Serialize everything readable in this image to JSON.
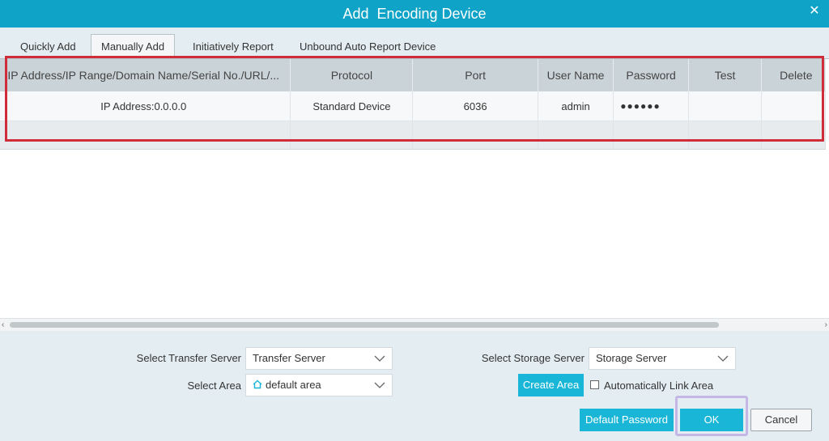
{
  "window": {
    "title": "Add  Encoding Device",
    "close_glyph": "✕"
  },
  "tabs": [
    {
      "label": "Quickly Add"
    },
    {
      "label": "Manually Add",
      "active": true
    },
    {
      "label": "Initiatively Report"
    },
    {
      "label": "Unbound Auto Report Device"
    }
  ],
  "table": {
    "columns": [
      "IP Address/IP Range/Domain Name/Serial No./URL/...",
      "Protocol",
      "Port",
      "User Name",
      "Password",
      "Test",
      "Delete"
    ],
    "rows": [
      {
        "address": "IP Address:0.0.0.0",
        "protocol": "Standard Device",
        "port": "6036",
        "user": "admin",
        "password": "●●●●●●",
        "test": "",
        "delete": ""
      },
      {
        "address": "",
        "protocol": "",
        "port": "",
        "user": "",
        "password": "",
        "test": "",
        "delete": ""
      }
    ]
  },
  "scrollbar": {
    "left_arrow": "‹",
    "right_arrow": "›"
  },
  "form": {
    "transfer_label": "Select Transfer Server",
    "transfer_value": "Transfer Server",
    "storage_label": "Select Storage Server",
    "storage_value": "Storage Server",
    "area_label": "Select Area",
    "area_value": "default area",
    "create_area": "Create Area",
    "auto_link": "Automatically Link Area"
  },
  "buttons": {
    "default_password": "Default Password",
    "ok": "OK",
    "cancel": "Cancel"
  },
  "colors": {
    "titlebar": "#0fa3c7",
    "accent_button": "#19b6d8",
    "highlight_red": "#d02d3a",
    "highlight_purple": "#c4b7e6"
  }
}
